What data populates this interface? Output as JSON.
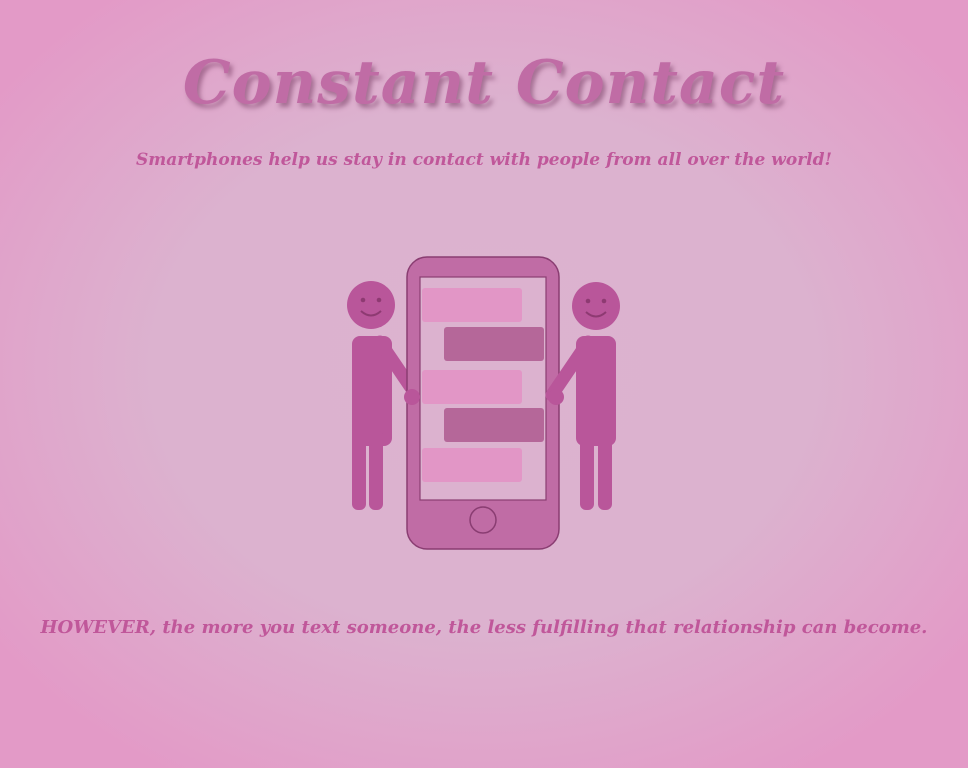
{
  "title": "Constant Contact",
  "subtitle": "Smartphones help us stay in contact with people from all over the world!",
  "footer": "HOWEVER, the more you text someone, the less fulfilling that relationship can become.",
  "illustration": {
    "icons": [
      "smiley-person-icon",
      "smartphone-icon",
      "chat-bubble-icon"
    ],
    "colors": {
      "person": "#b9569a",
      "phone_body": "#c06ca5",
      "screen": "#dcb2cf",
      "bubble_light": "#e296c6",
      "bubble_dark": "#b56799"
    }
  }
}
